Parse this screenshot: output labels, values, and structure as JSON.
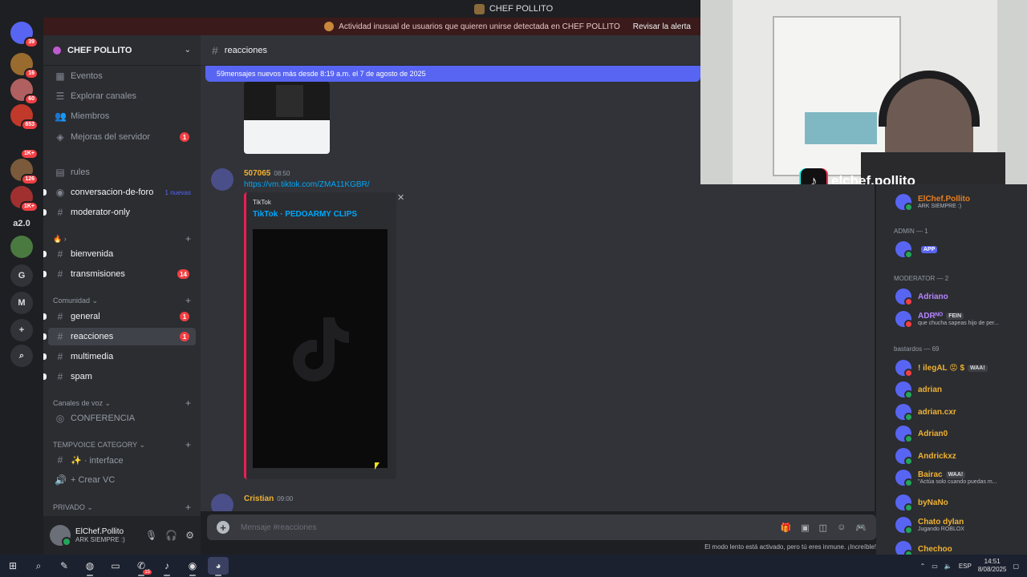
{
  "window": {
    "title": "CHEF POLLITO"
  },
  "alert": {
    "text": "Actividad inusual de usuarios que quieren unirse detectada en CHEF POLLITO",
    "action": "Revisar la alerta"
  },
  "rail": [
    {
      "label": "",
      "badge": "39",
      "color": "#5865f2"
    },
    {
      "label": "",
      "badge": "16",
      "color": "#9a6b2f"
    },
    {
      "label": "",
      "badge": "60",
      "color": "#b06060"
    },
    {
      "label": "",
      "badge": "653",
      "color": "#c0392b"
    },
    {
      "label": "",
      "badge": "1K+",
      "color": "#1e1f22"
    },
    {
      "label": "",
      "badge": "126",
      "color": "#7b5a3b"
    },
    {
      "label": "",
      "badge": "1K+",
      "color": "#a03030"
    },
    {
      "label": "a2.0",
      "badge": "",
      "color": "#1e1f22"
    },
    {
      "label": "",
      "badge": "",
      "color": "#4a7a40"
    },
    {
      "label": "G",
      "badge": "",
      "color": "#313338"
    },
    {
      "label": "M",
      "badge": "",
      "color": "#313338"
    },
    {
      "label": "+",
      "badge": "",
      "color": "#313338"
    },
    {
      "label": "⌕",
      "badge": "",
      "color": "#313338"
    }
  ],
  "guild": {
    "name": "CHEF POLLITO"
  },
  "sidebar": {
    "top": [
      {
        "label": "Eventos",
        "icon": "▦"
      },
      {
        "label": "Explorar canales",
        "icon": "☰"
      },
      {
        "label": "Miembros",
        "icon": "👥"
      },
      {
        "label": "Mejoras del servidor",
        "icon": "◈",
        "badge": "1"
      }
    ],
    "channels": [
      {
        "label": "rules",
        "icon": "▤",
        "state": ""
      },
      {
        "label": "conversacion-de-foro",
        "icon": "◉",
        "state": "unread",
        "new": "1 nuevas"
      },
      {
        "label": "moderator-only",
        "icon": "#",
        "state": "unread"
      }
    ],
    "emoji_cat": "🔥 ›",
    "group1": [
      {
        "label": "bienvenida",
        "icon": "#",
        "state": "unread"
      },
      {
        "label": "transmisiones",
        "icon": "#",
        "state": "unread",
        "badge": "14"
      }
    ],
    "cat_comunidad": "Comunidad ⌄",
    "comunidad": [
      {
        "label": "general",
        "icon": "#",
        "state": "unread",
        "badge": "1"
      },
      {
        "label": "reacciones",
        "icon": "#",
        "state": "active",
        "badge": "1"
      },
      {
        "label": "multimedia",
        "icon": "#",
        "state": "unread"
      },
      {
        "label": "spam",
        "icon": "#",
        "state": "unread"
      }
    ],
    "cat_voz": "Canales de voz ⌄",
    "voz": [
      {
        "label": "CONFERENCIA",
        "icon": "◎",
        "state": ""
      }
    ],
    "cat_temp": "TEMPVOICE CATEGORY ⌄",
    "temp": [
      {
        "label": "✨ · interface",
        "icon": "#",
        "state": ""
      },
      {
        "label": "+ Crear VC",
        "icon": "🔊",
        "state": ""
      }
    ],
    "cat_priv": "PRIVADO ⌄"
  },
  "user": {
    "name": "ElChef.Pollito",
    "status": "ARK SIEMPRE :)"
  },
  "channel": {
    "name": "reacciones"
  },
  "chat": {
    "new_banner": "59mensajes nuevos más desde 8:19 a.m. el 7 de agosto de 2025",
    "messages": [
      {
        "author": "507065",
        "time": "08:50",
        "link": "https://vm.tiktok.com/ZMA11KGBR/",
        "embed": {
          "provider": "TikTok",
          "title": "TikTok · PEDOARMY CLIPS"
        }
      },
      {
        "author": "Cristian",
        "time": "09:00"
      }
    ]
  },
  "input": {
    "placeholder": "Mensaje #reacciones"
  },
  "slowmode": "El modo lento está activado, pero tú eres inmune. ¡Increíble!",
  "members": {
    "top_user": {
      "name": "ElChef.Pollito",
      "sub": "ARK SIEMPRE :)",
      "color": "#e67e22"
    },
    "admin_cat": "ADMIN — 1",
    "admin": {
      "name": "",
      "tag": "APP",
      "color": "#c0392b"
    },
    "mod_cat": "MODERATOR — 2",
    "mods": [
      {
        "name": "Adriano",
        "sub": "",
        "color": "#b685ff"
      },
      {
        "name": "ADRᴺᴼ",
        "tag": "FEIN",
        "sub": "que chucha sapeas hijo de per...",
        "color": "#b685ff"
      }
    ],
    "bastardos_cat": "bastardos — 69",
    "bastardos": [
      {
        "name": "! ilegAL 😡 $",
        "tag": "WAA!",
        "sub": "",
        "color": "#f0b232"
      },
      {
        "name": "adrian",
        "sub": "",
        "color": "#f0b232"
      },
      {
        "name": "adrian.cxr",
        "sub": "",
        "color": "#f0b232"
      },
      {
        "name": "Adrian0",
        "sub": "",
        "color": "#f0b232"
      },
      {
        "name": "Andrickxz",
        "sub": "",
        "color": "#f0b232"
      },
      {
        "name": "Bairac",
        "tag": "WAA!",
        "sub": "\"Actúa solo cuando puedas m...",
        "color": "#f0b232"
      },
      {
        "name": "byNaNo",
        "sub": "",
        "color": "#f0b232"
      },
      {
        "name": "Chato dylan",
        "sub": "Jugando ROBLOX",
        "color": "#f0b232"
      },
      {
        "name": "Chechoo",
        "sub": "",
        "color": "#f0b232"
      }
    ]
  },
  "webcam": {
    "handle": "elchef.pollito"
  },
  "taskbar": {
    "lang": "ESP",
    "time": "14:51",
    "date": "8/08/2025",
    "whatsapp_badge": "15"
  }
}
